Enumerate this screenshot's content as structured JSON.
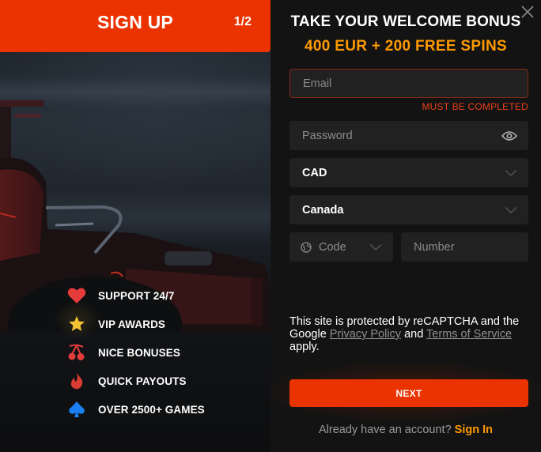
{
  "signup": {
    "title": "SIGN UP",
    "step": "1/2"
  },
  "features": [
    {
      "icon": "heart-icon",
      "label": "SUPPORT 24/7"
    },
    {
      "icon": "star-icon",
      "label": "VIP AWARDS"
    },
    {
      "icon": "cherries-icon",
      "label": "NICE BONUSES"
    },
    {
      "icon": "flame-icon",
      "label": "QUICK PAYOUTS"
    },
    {
      "icon": "spade-icon",
      "label": "OVER 2500+ GAMES"
    }
  ],
  "bonus": {
    "title": "TAKE YOUR WELCOME BONUS",
    "offer": "400 EUR + 200 FREE SPINS"
  },
  "form": {
    "email": {
      "placeholder": "Email",
      "value": "",
      "error": "MUST BE COMPLETED"
    },
    "password": {
      "placeholder": "Password",
      "value": "",
      "toggle_icon": "eye-icon"
    },
    "currency": {
      "selected": "CAD"
    },
    "country": {
      "selected": "Canada"
    },
    "phone_code": {
      "placeholder": "Code",
      "icon": "globe-icon"
    },
    "phone_number": {
      "placeholder": "Number",
      "value": ""
    }
  },
  "recaptcha": {
    "text_1": "This site is protected by reCAPTCHA and the Google ",
    "privacy_link": "Privacy Policy",
    "text_2": " and ",
    "terms_link": "Terms of Service",
    "text_3": " apply."
  },
  "actions": {
    "next_label": "NEXT",
    "signin_prompt": "Already have an account? ",
    "signin_label": "Sign In"
  },
  "colors": {
    "accent": "#ea3300",
    "bonus": "#ff9a00",
    "error": "#e8411a",
    "panel_bg": "#131313",
    "field_bg": "#212121"
  }
}
